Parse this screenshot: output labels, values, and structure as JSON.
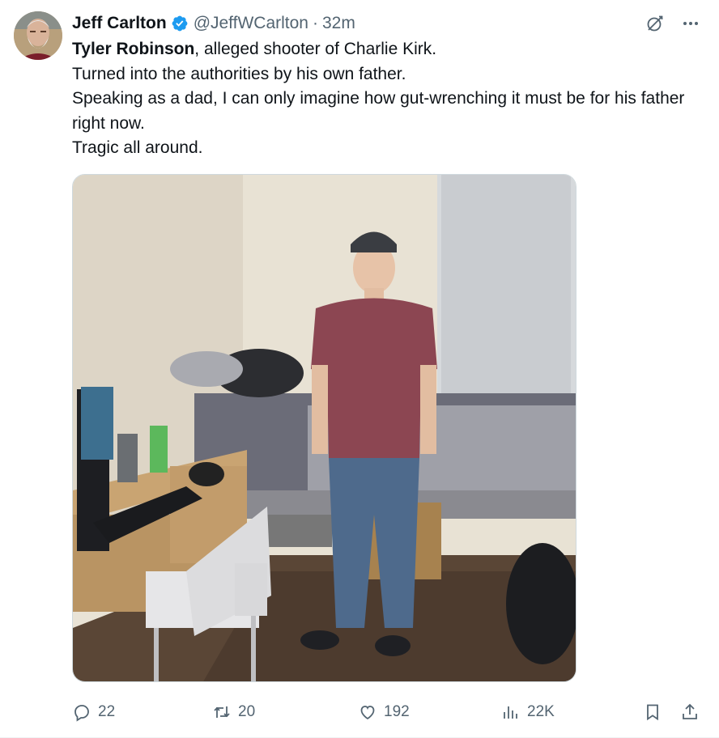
{
  "author": {
    "name": "Jeff Carlton",
    "handle": "@JeffWCarlton",
    "separator": "·",
    "time": "32m"
  },
  "tweet": {
    "bold_name": "Tyler Robinson",
    "line1_rest": ", alleged shooter of Charlie Kirk.",
    "line2": "Turned into the authorities by his own father.",
    "line3": "Speaking as a dad, I can only imagine how gut-wrenching it must be for his father right now.",
    "line4": "Tragic all around."
  },
  "icons": {
    "verified": "verified-badge-icon",
    "grok": "grok-icon",
    "more": "more-icon",
    "reply": "reply-icon",
    "retweet": "retweet-icon",
    "like": "heart-icon",
    "views": "views-icon",
    "bookmark": "bookmark-icon",
    "share": "share-icon"
  },
  "stats": {
    "replies": "22",
    "reposts": "20",
    "likes": "192",
    "views": "22K"
  },
  "colors": {
    "verified_blue": "#1d9bf0",
    "text_primary": "#0f1419",
    "text_secondary": "#536471"
  }
}
